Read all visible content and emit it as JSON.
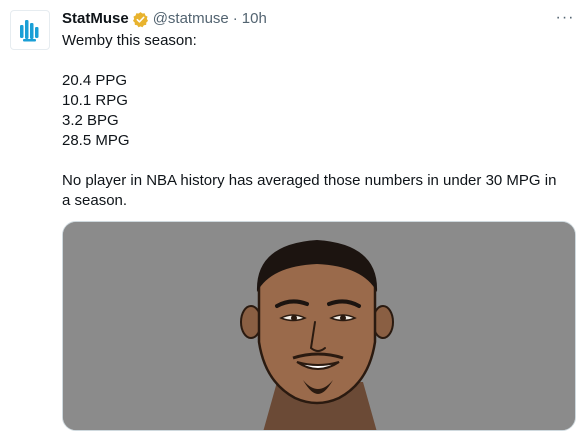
{
  "tweet": {
    "author": {
      "display_name": "StatMuse",
      "handle": "@statmuse",
      "verified": true,
      "avatar_icon": "statmuse-logo-icon"
    },
    "separator": "·",
    "time": "10h",
    "more_icon": "ellipsis-icon",
    "more_label": "···",
    "lines": {
      "intro": "Wemby this season:",
      "stat1": "20.4 PPG",
      "stat2": "10.1 RPG",
      "stat3": "3.2 BPG",
      "stat4": "28.5 MPG",
      "outro": "No player in NBA history has averaged those numbers in under 30 MPG in a season."
    },
    "media": {
      "type": "illustration",
      "background": "#8b8b8b"
    }
  },
  "colors": {
    "text": "#0f1419",
    "secondary": "#536471",
    "verified_badge": "#e8b32e",
    "statmuse_blue": "#1a9fd6"
  }
}
